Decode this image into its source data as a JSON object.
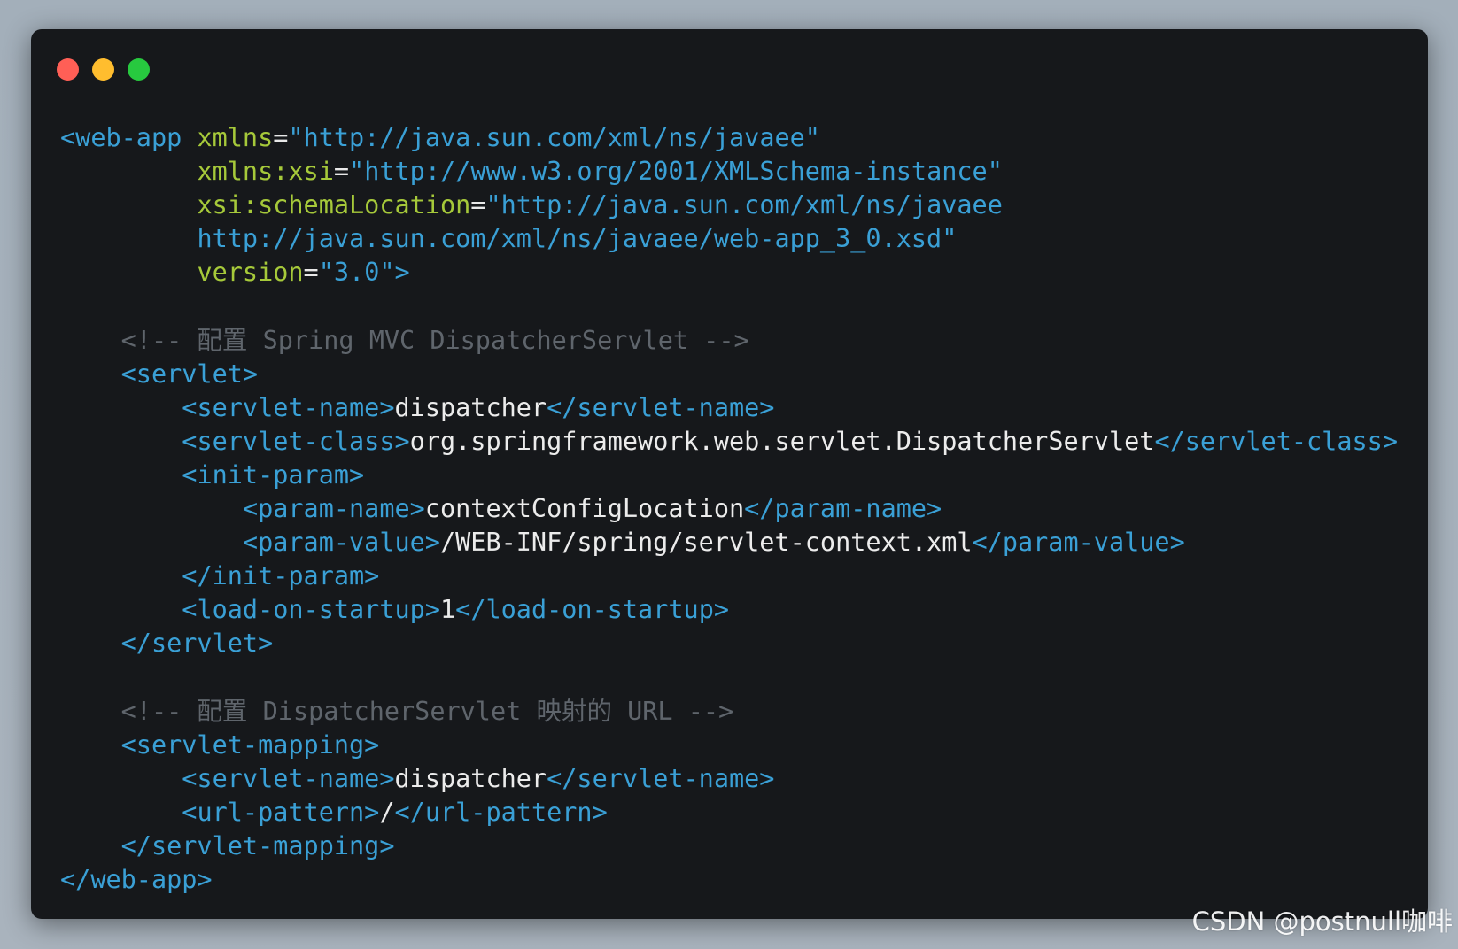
{
  "window": {
    "traffic_lights": [
      "close",
      "minimize",
      "maximize"
    ],
    "colors": {
      "background": "#16181b",
      "tag": "#3aa0d6",
      "attribute": "#a6c93a",
      "text": "#ececec",
      "comment": "#5f656c"
    }
  },
  "code": {
    "language": "xml",
    "lines": [
      [
        {
          "t": "tag",
          "v": "<web-app "
        },
        {
          "t": "attr",
          "v": "xmlns"
        },
        {
          "t": "eq",
          "v": "="
        },
        {
          "t": "str",
          "v": "\"http://java.sun.com/xml/ns/javaee\""
        }
      ],
      [
        {
          "t": "text",
          "v": "         "
        },
        {
          "t": "attr",
          "v": "xmlns:xsi"
        },
        {
          "t": "eq",
          "v": "="
        },
        {
          "t": "str",
          "v": "\"http://www.w3.org/2001/XMLSchema-instance\""
        }
      ],
      [
        {
          "t": "text",
          "v": "         "
        },
        {
          "t": "attr",
          "v": "xsi:schemaLocation"
        },
        {
          "t": "eq",
          "v": "="
        },
        {
          "t": "str",
          "v": "\"http://java.sun.com/xml/ns/javaee"
        }
      ],
      [
        {
          "t": "text",
          "v": "         "
        },
        {
          "t": "str",
          "v": "http://java.sun.com/xml/ns/javaee/web-app_3_0.xsd\""
        }
      ],
      [
        {
          "t": "text",
          "v": "         "
        },
        {
          "t": "attr",
          "v": "version"
        },
        {
          "t": "eq",
          "v": "="
        },
        {
          "t": "str",
          "v": "\"3.0\""
        },
        {
          "t": "tag",
          "v": ">"
        }
      ],
      [],
      [
        {
          "t": "text",
          "v": "    "
        },
        {
          "t": "comment",
          "v": "<!-- 配置 Spring MVC DispatcherServlet -->"
        }
      ],
      [
        {
          "t": "text",
          "v": "    "
        },
        {
          "t": "tag",
          "v": "<servlet>"
        }
      ],
      [
        {
          "t": "text",
          "v": "        "
        },
        {
          "t": "tag",
          "v": "<servlet-name>"
        },
        {
          "t": "text",
          "v": "dispatcher"
        },
        {
          "t": "tag",
          "v": "</servlet-name>"
        }
      ],
      [
        {
          "t": "text",
          "v": "        "
        },
        {
          "t": "tag",
          "v": "<servlet-class>"
        },
        {
          "t": "text",
          "v": "org.springframework.web.servlet.DispatcherServlet"
        },
        {
          "t": "tag",
          "v": "</servlet-class>"
        }
      ],
      [
        {
          "t": "text",
          "v": "        "
        },
        {
          "t": "tag",
          "v": "<init-param>"
        }
      ],
      [
        {
          "t": "text",
          "v": "            "
        },
        {
          "t": "tag",
          "v": "<param-name>"
        },
        {
          "t": "text",
          "v": "contextConfigLocation"
        },
        {
          "t": "tag",
          "v": "</param-name>"
        }
      ],
      [
        {
          "t": "text",
          "v": "            "
        },
        {
          "t": "tag",
          "v": "<param-value>"
        },
        {
          "t": "text",
          "v": "/WEB-INF/spring/servlet-context.xml"
        },
        {
          "t": "tag",
          "v": "</param-value>"
        }
      ],
      [
        {
          "t": "text",
          "v": "        "
        },
        {
          "t": "tag",
          "v": "</init-param>"
        }
      ],
      [
        {
          "t": "text",
          "v": "        "
        },
        {
          "t": "tag",
          "v": "<load-on-startup>"
        },
        {
          "t": "text",
          "v": "1"
        },
        {
          "t": "tag",
          "v": "</load-on-startup>"
        }
      ],
      [
        {
          "t": "text",
          "v": "    "
        },
        {
          "t": "tag",
          "v": "</servlet>"
        }
      ],
      [],
      [
        {
          "t": "text",
          "v": "    "
        },
        {
          "t": "comment",
          "v": "<!-- 配置 DispatcherServlet 映射的 URL -->"
        }
      ],
      [
        {
          "t": "text",
          "v": "    "
        },
        {
          "t": "tag",
          "v": "<servlet-mapping>"
        }
      ],
      [
        {
          "t": "text",
          "v": "        "
        },
        {
          "t": "tag",
          "v": "<servlet-name>"
        },
        {
          "t": "text",
          "v": "dispatcher"
        },
        {
          "t": "tag",
          "v": "</servlet-name>"
        }
      ],
      [
        {
          "t": "text",
          "v": "        "
        },
        {
          "t": "tag",
          "v": "<url-pattern>"
        },
        {
          "t": "text",
          "v": "/"
        },
        {
          "t": "tag",
          "v": "</url-pattern>"
        }
      ],
      [
        {
          "t": "text",
          "v": "    "
        },
        {
          "t": "tag",
          "v": "</servlet-mapping>"
        }
      ],
      [
        {
          "t": "tag",
          "v": "</web-app>"
        }
      ]
    ]
  },
  "watermark": {
    "text": "CSDN @postnull咖啡"
  }
}
